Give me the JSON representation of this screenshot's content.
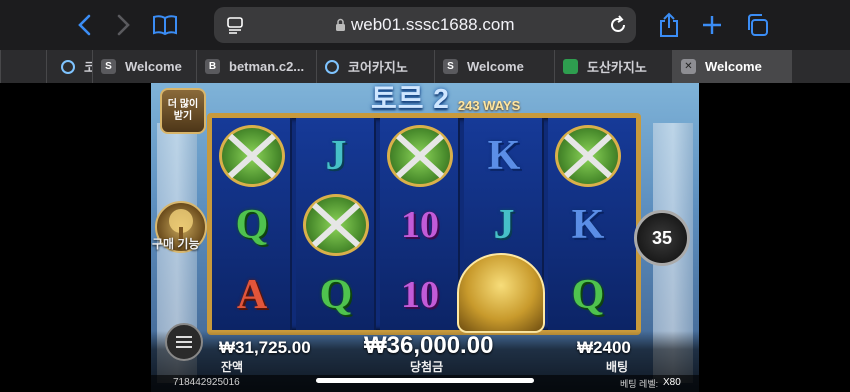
{
  "browser": {
    "url": "web01.sssc1688.com",
    "tabs": [
      {
        "icon": "o",
        "label": "코"
      },
      {
        "icon": "S",
        "label": "Welcome"
      },
      {
        "icon": "B",
        "label": "betman.c2..."
      },
      {
        "icon": "o",
        "label": "코어카지노"
      },
      {
        "icon": "S",
        "label": "Welcome"
      },
      {
        "icon": "img",
        "label": "도산카지노"
      },
      {
        "icon": "x",
        "label": "Welcome"
      }
    ]
  },
  "game": {
    "title": "토르 2",
    "ways": "243 WAYS",
    "more_label": "더 많이 받기",
    "buy_label": "구매 기능",
    "spin_count": "35",
    "balance_label": "잔액",
    "balance_value": "₩31,725.00",
    "win_label": "당첨금",
    "win_value": "₩36,000.00",
    "bet_label": "배팅",
    "bet_value": "₩2400",
    "session_id": "718442925016",
    "bet_level_label": "베팅 레벨:",
    "multiplier": "X80",
    "reels": [
      [
        "swords",
        "Q",
        "A"
      ],
      [
        "J",
        "swords",
        "Q"
      ],
      [
        "swords",
        "10",
        "10"
      ],
      [
        "K",
        "J",
        "helmet"
      ],
      [
        "swords",
        "K",
        "Q"
      ]
    ]
  }
}
